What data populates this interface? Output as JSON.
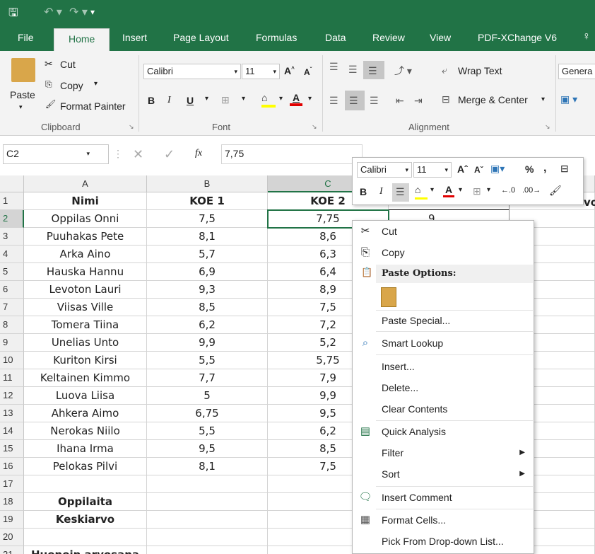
{
  "tabs": [
    "File",
    "Home",
    "Insert",
    "Page Layout",
    "Formulas",
    "Data",
    "Review",
    "View",
    "PDF-XChange V6"
  ],
  "clipboard": {
    "paste": "Paste",
    "cut": "Cut",
    "copy": "Copy",
    "format_painter": "Format Painter",
    "label": "Clipboard"
  },
  "font": {
    "name": "Calibri",
    "size": "11",
    "label": "Font"
  },
  "alignment": {
    "wrap": "Wrap Text",
    "merge": "Merge & Center",
    "label": "Alignment"
  },
  "number": {
    "format": "Genera"
  },
  "formula": {
    "name_box": "C2",
    "fx": "fx",
    "value": "7,75"
  },
  "columns": [
    "A",
    "B",
    "C"
  ],
  "rows": [
    {
      "n": "1",
      "a": "Nimi",
      "b": "KOE 1",
      "c": "KOE 2",
      "bold": true
    },
    {
      "n": "2",
      "a": "Oppilas Onni",
      "b": "7,5",
      "c": "7,75"
    },
    {
      "n": "3",
      "a": "Puuhakas Pete",
      "b": "8,1",
      "c": "8,6"
    },
    {
      "n": "4",
      "a": "Arka Aino",
      "b": "5,7",
      "c": "6,3"
    },
    {
      "n": "5",
      "a": "Hauska Hannu",
      "b": "6,9",
      "c": "6,4"
    },
    {
      "n": "6",
      "a": "Levoton Lauri",
      "b": "9,3",
      "c": "8,9"
    },
    {
      "n": "7",
      "a": "Viisas Ville",
      "b": "8,5",
      "c": "7,5"
    },
    {
      "n": "8",
      "a": "Tomera Tiina",
      "b": "6,2",
      "c": "7,2"
    },
    {
      "n": "9",
      "a": "Unelias Unto",
      "b": "9,9",
      "c": "5,2"
    },
    {
      "n": "10",
      "a": "Kuriton Kirsi",
      "b": "5,5",
      "c": "5,75"
    },
    {
      "n": "11",
      "a": "Keltainen Kimmo",
      "b": "7,7",
      "c": "7,9"
    },
    {
      "n": "12",
      "a": "Luova Liisa",
      "b": "5",
      "c": "9,9"
    },
    {
      "n": "13",
      "a": "Ahkera Aimo",
      "b": "6,75",
      "c": "9,5"
    },
    {
      "n": "14",
      "a": "Nerokas Niilo",
      "b": "5,5",
      "c": "6,2"
    },
    {
      "n": "15",
      "a": "Ihana Irma",
      "b": "9,5",
      "c": "8,5"
    },
    {
      "n": "16",
      "a": "Pelokas Pilvi",
      "b": "8,1",
      "c": "7,5"
    },
    {
      "n": "17",
      "a": "",
      "b": "",
      "c": ""
    },
    {
      "n": "18",
      "a": "Oppilaita",
      "b": "",
      "c": "",
      "bold": true
    },
    {
      "n": "19",
      "a": "Keskiarvo",
      "b": "",
      "c": "",
      "bold": true
    },
    {
      "n": "20",
      "a": "",
      "b": "",
      "c": ""
    },
    {
      "n": "21",
      "a": "Huonoin arvosana",
      "b": "",
      "c": "",
      "bold": true
    }
  ],
  "partial_header": {
    "d_value": "9",
    "e_header": "vo"
  },
  "mini_toolbar": {
    "font": "Calibri",
    "size": "11"
  },
  "context_menu": [
    "Cut",
    "Copy",
    "Paste Options:",
    "Paste Special...",
    "Smart Lookup",
    "Insert...",
    "Delete...",
    "Clear Contents",
    "Quick Analysis",
    "Filter",
    "Sort",
    "Insert Comment",
    "Format Cells...",
    "Pick From Drop-down List..."
  ]
}
